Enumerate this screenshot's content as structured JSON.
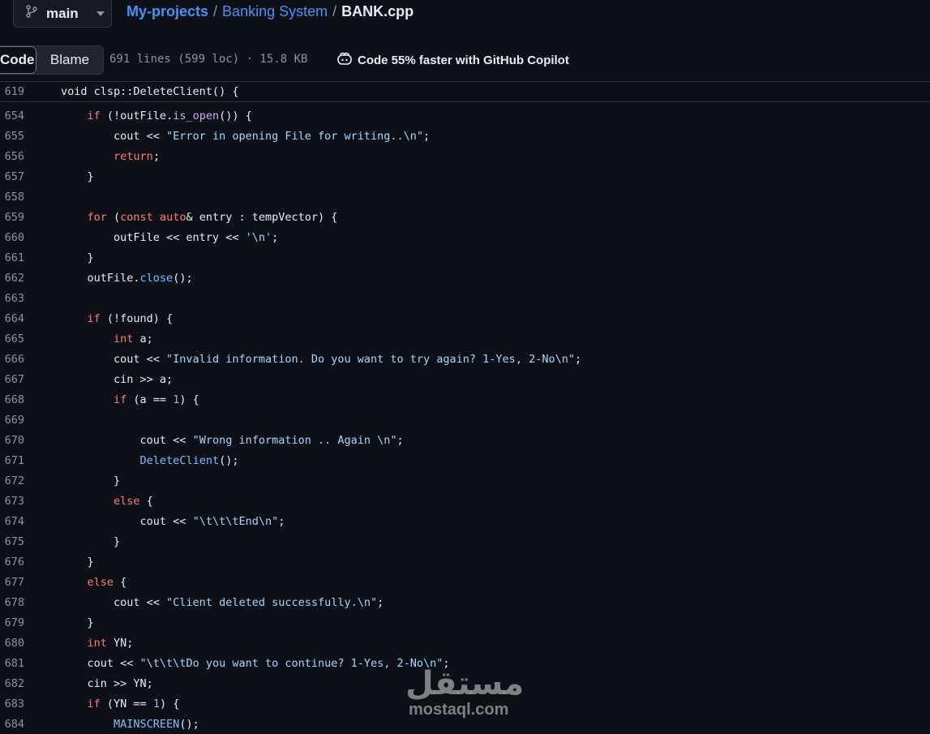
{
  "topbar": {
    "branch": "main",
    "breadcrumb": {
      "repo": "My-projects",
      "folder": "Banking System",
      "file": "BANK.cpp",
      "separator": "/"
    }
  },
  "toolbar": {
    "code_label": "Code",
    "blame_label": "Blame",
    "file_meta": "691 lines (599 loc) · 15.8 KB",
    "copilot_text": "Code 55% faster with GitHub Copilot"
  },
  "sticky": {
    "line_number": "619",
    "text": "void clsp::DeleteClient() {"
  },
  "code": {
    "lines": [
      {
        "n": "654"
      },
      {
        "n": "655"
      },
      {
        "n": "656"
      },
      {
        "n": "657"
      },
      {
        "n": "658"
      },
      {
        "n": "659"
      },
      {
        "n": "660"
      },
      {
        "n": "661"
      },
      {
        "n": "662"
      },
      {
        "n": "663"
      },
      {
        "n": "664"
      },
      {
        "n": "665"
      },
      {
        "n": "666"
      },
      {
        "n": "667"
      },
      {
        "n": "668"
      },
      {
        "n": "669"
      },
      {
        "n": "670"
      },
      {
        "n": "671"
      },
      {
        "n": "672"
      },
      {
        "n": "673"
      },
      {
        "n": "674"
      },
      {
        "n": "675"
      },
      {
        "n": "676"
      },
      {
        "n": "677"
      },
      {
        "n": "678"
      },
      {
        "n": "679"
      },
      {
        "n": "680"
      },
      {
        "n": "681"
      },
      {
        "n": "682"
      },
      {
        "n": "683"
      },
      {
        "n": "684"
      }
    ]
  },
  "icons": {
    "branch": "git-branch-icon",
    "caret": "chevron-down-icon",
    "copilot": "copilot-icon"
  },
  "watermark": {
    "arabic": "مستقل",
    "latin": "mostaql.com"
  },
  "colors": {
    "background": "#0d1117",
    "link": "#4493f8",
    "keyword": "#ff7b72",
    "function": "#d2a8ff",
    "string": "#a5d6ff",
    "number": "#79c0ff"
  }
}
